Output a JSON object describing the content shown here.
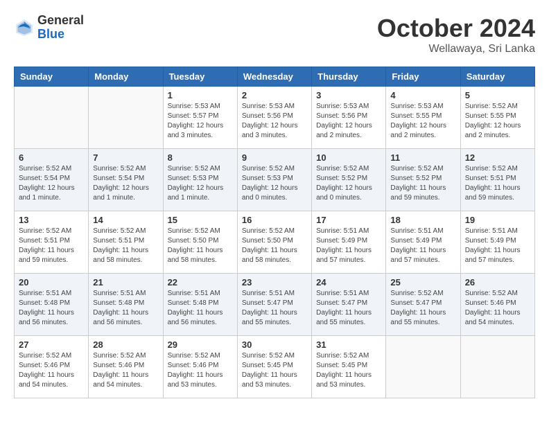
{
  "header": {
    "logo_general": "General",
    "logo_blue": "Blue",
    "title": "October 2024",
    "location": "Wellawaya, Sri Lanka"
  },
  "days_of_week": [
    "Sunday",
    "Monday",
    "Tuesday",
    "Wednesday",
    "Thursday",
    "Friday",
    "Saturday"
  ],
  "weeks": [
    [
      {
        "day": "",
        "info": ""
      },
      {
        "day": "",
        "info": ""
      },
      {
        "day": "1",
        "info": "Sunrise: 5:53 AM\nSunset: 5:57 PM\nDaylight: 12 hours\nand 3 minutes."
      },
      {
        "day": "2",
        "info": "Sunrise: 5:53 AM\nSunset: 5:56 PM\nDaylight: 12 hours\nand 3 minutes."
      },
      {
        "day": "3",
        "info": "Sunrise: 5:53 AM\nSunset: 5:56 PM\nDaylight: 12 hours\nand 2 minutes."
      },
      {
        "day": "4",
        "info": "Sunrise: 5:53 AM\nSunset: 5:55 PM\nDaylight: 12 hours\nand 2 minutes."
      },
      {
        "day": "5",
        "info": "Sunrise: 5:52 AM\nSunset: 5:55 PM\nDaylight: 12 hours\nand 2 minutes."
      }
    ],
    [
      {
        "day": "6",
        "info": "Sunrise: 5:52 AM\nSunset: 5:54 PM\nDaylight: 12 hours\nand 1 minute."
      },
      {
        "day": "7",
        "info": "Sunrise: 5:52 AM\nSunset: 5:54 PM\nDaylight: 12 hours\nand 1 minute."
      },
      {
        "day": "8",
        "info": "Sunrise: 5:52 AM\nSunset: 5:53 PM\nDaylight: 12 hours\nand 1 minute."
      },
      {
        "day": "9",
        "info": "Sunrise: 5:52 AM\nSunset: 5:53 PM\nDaylight: 12 hours\nand 0 minutes."
      },
      {
        "day": "10",
        "info": "Sunrise: 5:52 AM\nSunset: 5:52 PM\nDaylight: 12 hours\nand 0 minutes."
      },
      {
        "day": "11",
        "info": "Sunrise: 5:52 AM\nSunset: 5:52 PM\nDaylight: 11 hours\nand 59 minutes."
      },
      {
        "day": "12",
        "info": "Sunrise: 5:52 AM\nSunset: 5:51 PM\nDaylight: 11 hours\nand 59 minutes."
      }
    ],
    [
      {
        "day": "13",
        "info": "Sunrise: 5:52 AM\nSunset: 5:51 PM\nDaylight: 11 hours\nand 59 minutes."
      },
      {
        "day": "14",
        "info": "Sunrise: 5:52 AM\nSunset: 5:51 PM\nDaylight: 11 hours\nand 58 minutes."
      },
      {
        "day": "15",
        "info": "Sunrise: 5:52 AM\nSunset: 5:50 PM\nDaylight: 11 hours\nand 58 minutes."
      },
      {
        "day": "16",
        "info": "Sunrise: 5:52 AM\nSunset: 5:50 PM\nDaylight: 11 hours\nand 58 minutes."
      },
      {
        "day": "17",
        "info": "Sunrise: 5:51 AM\nSunset: 5:49 PM\nDaylight: 11 hours\nand 57 minutes."
      },
      {
        "day": "18",
        "info": "Sunrise: 5:51 AM\nSunset: 5:49 PM\nDaylight: 11 hours\nand 57 minutes."
      },
      {
        "day": "19",
        "info": "Sunrise: 5:51 AM\nSunset: 5:49 PM\nDaylight: 11 hours\nand 57 minutes."
      }
    ],
    [
      {
        "day": "20",
        "info": "Sunrise: 5:51 AM\nSunset: 5:48 PM\nDaylight: 11 hours\nand 56 minutes."
      },
      {
        "day": "21",
        "info": "Sunrise: 5:51 AM\nSunset: 5:48 PM\nDaylight: 11 hours\nand 56 minutes."
      },
      {
        "day": "22",
        "info": "Sunrise: 5:51 AM\nSunset: 5:48 PM\nDaylight: 11 hours\nand 56 minutes."
      },
      {
        "day": "23",
        "info": "Sunrise: 5:51 AM\nSunset: 5:47 PM\nDaylight: 11 hours\nand 55 minutes."
      },
      {
        "day": "24",
        "info": "Sunrise: 5:51 AM\nSunset: 5:47 PM\nDaylight: 11 hours\nand 55 minutes."
      },
      {
        "day": "25",
        "info": "Sunrise: 5:52 AM\nSunset: 5:47 PM\nDaylight: 11 hours\nand 55 minutes."
      },
      {
        "day": "26",
        "info": "Sunrise: 5:52 AM\nSunset: 5:46 PM\nDaylight: 11 hours\nand 54 minutes."
      }
    ],
    [
      {
        "day": "27",
        "info": "Sunrise: 5:52 AM\nSunset: 5:46 PM\nDaylight: 11 hours\nand 54 minutes."
      },
      {
        "day": "28",
        "info": "Sunrise: 5:52 AM\nSunset: 5:46 PM\nDaylight: 11 hours\nand 54 minutes."
      },
      {
        "day": "29",
        "info": "Sunrise: 5:52 AM\nSunset: 5:46 PM\nDaylight: 11 hours\nand 53 minutes."
      },
      {
        "day": "30",
        "info": "Sunrise: 5:52 AM\nSunset: 5:45 PM\nDaylight: 11 hours\nand 53 minutes."
      },
      {
        "day": "31",
        "info": "Sunrise: 5:52 AM\nSunset: 5:45 PM\nDaylight: 11 hours\nand 53 minutes."
      },
      {
        "day": "",
        "info": ""
      },
      {
        "day": "",
        "info": ""
      }
    ]
  ]
}
